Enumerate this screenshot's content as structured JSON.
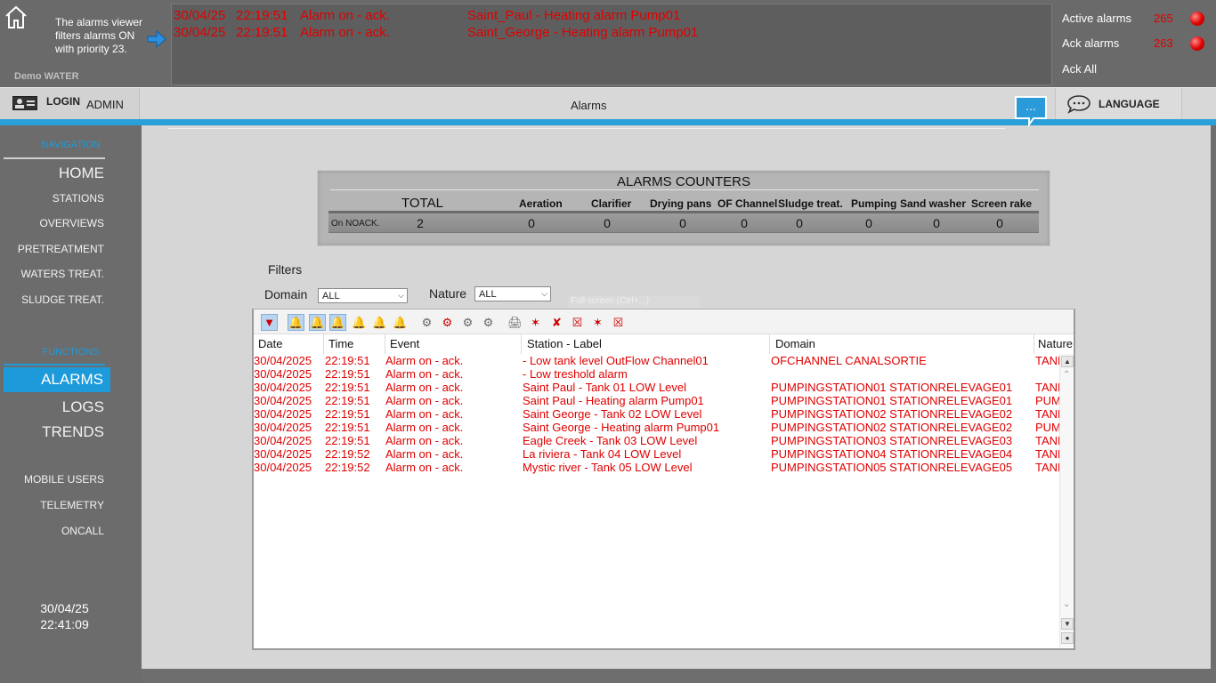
{
  "banner": {
    "viewer_note": "The alarms viewer filters alarms ON with priority 23.",
    "demo_label": "Demo WATER",
    "alarms": [
      {
        "date": "30/04/25",
        "time": "22:19:51",
        "event": "Alarm on - ack.",
        "label": "Saint_Paul - Heating alarm Pump01"
      },
      {
        "date": "30/04/25",
        "time": "22:19:51",
        "event": "Alarm on - ack.",
        "label": "Saint_George - Heating alarm Pump01"
      }
    ],
    "active_alarms_label": "Active alarms",
    "active_alarms_value": "265",
    "ack_alarms_label": "Ack alarms",
    "ack_alarms_value": "263",
    "ack_all_label": "Ack All"
  },
  "navbar": {
    "login_label": "LOGIN",
    "user": "ADMIN",
    "page_title": "Alarms",
    "chat_glyph": "...",
    "language_label": "LANGUAGE"
  },
  "sidebar": {
    "navigation_header": "NAVIGATION",
    "functions_header": "FUNCTIONS",
    "items": {
      "home": "HOME",
      "stations": "STATIONS",
      "overviews": "OVERVIEWS",
      "pretreatment": "PRETREATMENT",
      "waters_treat": "WATERS TREAT.",
      "sludge_treat": "SLUDGE TREAT.",
      "alarms": "ALARMS",
      "logs": "LOGS",
      "trends": "TRENDS",
      "mobile_users": "MOBILE USERS",
      "telemetry": "TELEMETRY",
      "oncall": "ONCALL"
    },
    "clock_date": "30/04/25",
    "clock_time": "22:41:09"
  },
  "counters": {
    "title": "ALARMS COUNTERS",
    "total_label": "TOTAL",
    "row_label": "On NOACK.",
    "total_value": "2",
    "columns": [
      "Aeration",
      "Clarifier",
      "Drying pans",
      "OF Channel",
      "Sludge treat.",
      "Pumping",
      "Sand washer",
      "Screen rake"
    ],
    "values": [
      "0",
      "0",
      "0",
      "0",
      "0",
      "0",
      "0",
      "0"
    ]
  },
  "filters": {
    "title": "Filters",
    "domain_label": "Domain",
    "domain_value": "ALL",
    "nature_label": "Nature",
    "nature_value": "ALL",
    "hint": "Full screen (Ctrl+...)"
  },
  "grid": {
    "columns": {
      "date": "Date",
      "time": "Time",
      "event": "Event",
      "label": "Station - Label",
      "domain": "Domain",
      "nature": "Nature"
    },
    "rows": [
      {
        "date": "30/04/2025",
        "time": "22:19:51",
        "event": "Alarm on - ack.",
        "label": " - Low tank level OutFlow  Channel01",
        "domain": "OFCHANNEL  CANALSORTIE",
        "nature": "TANK"
      },
      {
        "date": "30/04/2025",
        "time": "22:19:51",
        "event": "Alarm on - ack.",
        "label": " - Low treshold alarm",
        "domain": "",
        "nature": ""
      },
      {
        "date": "30/04/2025",
        "time": "22:19:51",
        "event": "Alarm on - ack.",
        "label": "Saint  Paul - Tank 01 LOW Level",
        "domain": "PUMPINGSTATION01  STATIONRELEVAGE01",
        "nature": "TANK"
      },
      {
        "date": "30/04/2025",
        "time": "22:19:51",
        "event": "Alarm on - ack.",
        "label": "Saint  Paul - Heating alarm Pump01",
        "domain": "PUMPINGSTATION01  STATIONRELEVAGE01",
        "nature": "PUMP"
      },
      {
        "date": "30/04/2025",
        "time": "22:19:51",
        "event": "Alarm on - ack.",
        "label": "Saint  George - Tank 02 LOW Level",
        "domain": "PUMPINGSTATION02  STATIONRELEVAGE02",
        "nature": "TANK"
      },
      {
        "date": "30/04/2025",
        "time": "22:19:51",
        "event": "Alarm on - ack.",
        "label": "Saint  George - Heating alarm Pump01",
        "domain": "PUMPINGSTATION02  STATIONRELEVAGE02",
        "nature": "PUMP"
      },
      {
        "date": "30/04/2025",
        "time": "22:19:51",
        "event": "Alarm on - ack.",
        "label": "Eagle Creek - Tank 03 LOW Level",
        "domain": "PUMPINGSTATION03  STATIONRELEVAGE03",
        "nature": "TANK"
      },
      {
        "date": "30/04/2025",
        "time": "22:19:52",
        "event": "Alarm on - ack.",
        "label": "La riviera - Tank 04 LOW Level",
        "domain": "PUMPINGSTATION04  STATIONRELEVAGE04",
        "nature": "TANK"
      },
      {
        "date": "30/04/2025",
        "time": "22:19:52",
        "event": "Alarm on - ack.",
        "label": "Mystic river - Tank 05 LOW Level",
        "domain": "PUMPINGSTATION05  STATIONRELEVAGE05",
        "nature": "TANK"
      }
    ]
  },
  "colors": {
    "alarm_red": "#e00000",
    "accent_blue": "#1d9ad9"
  }
}
